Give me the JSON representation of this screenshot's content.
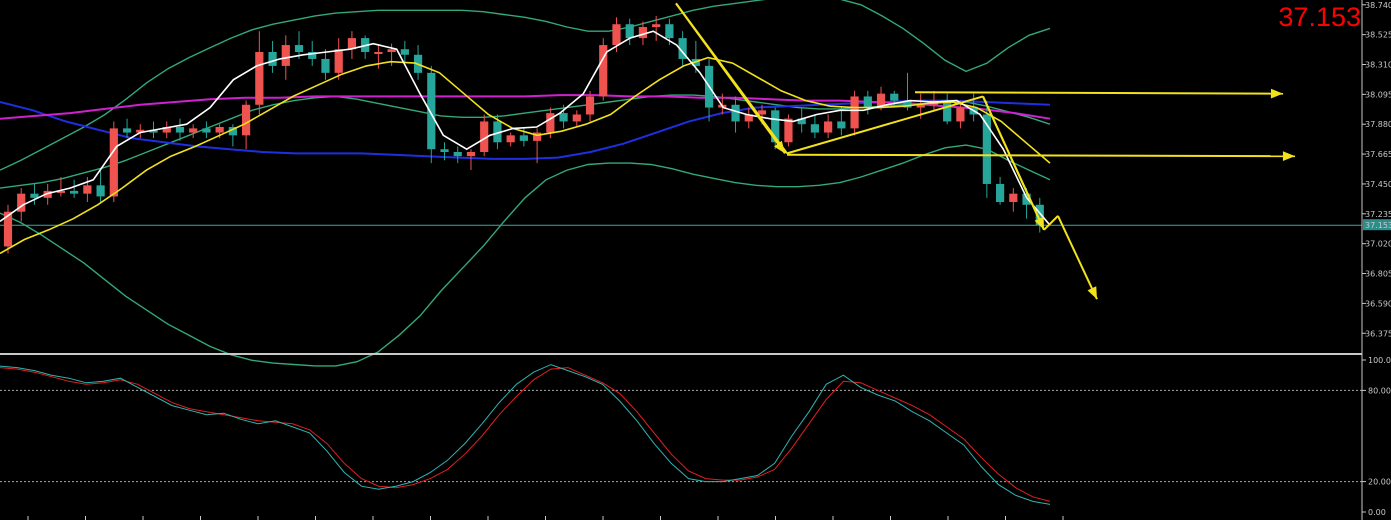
{
  "chart_data": {
    "type": "candlestick",
    "current_price": "37.153",
    "current_price_tag": "37.153",
    "price_axis": {
      "ticks": [
        "38.740",
        "38.525",
        "38.310",
        "38.095",
        "37.880",
        "37.665",
        "37.450",
        "37.235",
        "37.020",
        "36.805",
        "36.590",
        "36.375"
      ],
      "ylim": [
        36.24,
        38.76
      ]
    },
    "oscillator": {
      "type": "stochastic",
      "ticks": [
        "100.00",
        "80.00",
        "20.00",
        "0.00"
      ],
      "levels": [
        80,
        20
      ],
      "ylim": [
        0,
        100
      ]
    },
    "candles": [
      [
        37.0,
        37.3,
        36.95,
        37.25
      ],
      [
        37.25,
        37.42,
        37.18,
        37.38
      ],
      [
        37.38,
        37.45,
        37.3,
        37.35
      ],
      [
        37.35,
        37.45,
        37.3,
        37.4
      ],
      [
        37.4,
        37.5,
        37.36,
        37.4
      ],
      [
        37.4,
        37.48,
        37.35,
        37.38
      ],
      [
        37.38,
        37.5,
        37.32,
        37.44
      ],
      [
        37.44,
        37.55,
        37.32,
        37.36
      ],
      [
        37.36,
        37.9,
        37.32,
        37.85
      ],
      [
        37.85,
        37.92,
        37.78,
        37.82
      ],
      [
        37.82,
        37.88,
        37.78,
        37.84
      ],
      [
        37.84,
        37.9,
        37.78,
        37.82
      ],
      [
        37.82,
        37.9,
        37.78,
        37.86
      ],
      [
        37.86,
        37.92,
        37.76,
        37.82
      ],
      [
        37.82,
        37.88,
        37.78,
        37.85
      ],
      [
        37.85,
        37.9,
        37.78,
        37.82
      ],
      [
        37.82,
        37.88,
        37.78,
        37.86
      ],
      [
        37.86,
        37.88,
        37.72,
        37.8
      ],
      [
        37.8,
        38.05,
        37.7,
        38.02
      ],
      [
        38.02,
        38.55,
        37.95,
        38.4
      ],
      [
        38.4,
        38.48,
        38.25,
        38.3
      ],
      [
        38.3,
        38.52,
        38.2,
        38.45
      ],
      [
        38.45,
        38.55,
        38.35,
        38.4
      ],
      [
        38.4,
        38.48,
        38.3,
        38.35
      ],
      [
        38.35,
        38.42,
        38.2,
        38.25
      ],
      [
        38.25,
        38.5,
        38.2,
        38.42
      ],
      [
        38.42,
        38.55,
        38.35,
        38.5
      ],
      [
        38.5,
        38.52,
        38.35,
        38.4
      ],
      [
        38.4,
        38.45,
        38.28,
        38.4
      ],
      [
        38.4,
        38.46,
        38.3,
        38.42
      ],
      [
        38.42,
        38.48,
        38.32,
        38.38
      ],
      [
        38.38,
        38.45,
        38.2,
        38.25
      ],
      [
        38.25,
        38.3,
        37.6,
        37.7
      ],
      [
        37.7,
        37.75,
        37.62,
        37.68
      ],
      [
        37.68,
        37.72,
        37.6,
        37.65
      ],
      [
        37.65,
        37.7,
        37.55,
        37.68
      ],
      [
        37.68,
        37.95,
        37.65,
        37.9
      ],
      [
        37.9,
        37.95,
        37.7,
        37.75
      ],
      [
        37.75,
        37.82,
        37.72,
        37.8
      ],
      [
        37.8,
        37.85,
        37.72,
        37.76
      ],
      [
        37.76,
        37.85,
        37.6,
        37.82
      ],
      [
        37.82,
        38.0,
        37.78,
        37.96
      ],
      [
        37.96,
        38.02,
        37.85,
        37.9
      ],
      [
        37.9,
        37.98,
        37.86,
        37.95
      ],
      [
        37.95,
        38.12,
        37.9,
        38.08
      ],
      [
        38.08,
        38.5,
        38.05,
        38.45
      ],
      [
        38.45,
        38.65,
        38.4,
        38.6
      ],
      [
        38.6,
        38.64,
        38.45,
        38.5
      ],
      [
        38.5,
        38.62,
        38.45,
        38.58
      ],
      [
        38.58,
        38.66,
        38.48,
        38.6
      ],
      [
        38.6,
        38.64,
        38.45,
        38.5
      ],
      [
        38.5,
        38.55,
        38.3,
        38.35
      ],
      [
        38.35,
        38.48,
        38.25,
        38.3
      ],
      [
        38.3,
        38.35,
        37.9,
        38.0
      ],
      [
        38.0,
        38.1,
        37.95,
        38.02
      ],
      [
        38.02,
        38.08,
        37.82,
        37.9
      ],
      [
        37.9,
        38.0,
        37.85,
        37.95
      ],
      [
        37.95,
        38.02,
        37.88,
        37.98
      ],
      [
        37.98,
        38.0,
        37.7,
        37.75
      ],
      [
        37.75,
        37.95,
        37.72,
        37.92
      ],
      [
        37.92,
        38.0,
        37.82,
        37.88
      ],
      [
        37.88,
        37.95,
        37.78,
        37.82
      ],
      [
        37.82,
        37.95,
        37.78,
        37.9
      ],
      [
        37.9,
        38.0,
        37.8,
        37.85
      ],
      [
        37.85,
        38.12,
        37.8,
        38.08
      ],
      [
        38.08,
        38.12,
        37.95,
        38.0
      ],
      [
        38.0,
        38.15,
        37.98,
        38.1
      ],
      [
        38.1,
        38.12,
        38.0,
        38.05
      ],
      [
        38.05,
        38.25,
        37.98,
        38.0
      ],
      [
        38.0,
        38.1,
        37.92,
        38.02
      ],
      [
        38.02,
        38.12,
        37.98,
        38.05
      ],
      [
        38.05,
        38.1,
        37.88,
        37.9
      ],
      [
        37.9,
        38.05,
        37.85,
        38.0
      ],
      [
        38.0,
        38.1,
        37.9,
        37.95
      ],
      [
        37.95,
        38.05,
        37.35,
        37.45
      ],
      [
        37.45,
        37.5,
        37.3,
        37.32
      ],
      [
        37.32,
        37.42,
        37.25,
        37.38
      ],
      [
        37.38,
        37.42,
        37.2,
        37.3
      ],
      [
        37.3,
        37.35,
        37.1,
        37.153
      ]
    ],
    "bollinger": {
      "upper": [
        37.55,
        37.62,
        37.7,
        37.78,
        37.86,
        37.95,
        38.06,
        38.18,
        38.28,
        38.36,
        38.43,
        38.5,
        38.56,
        38.6,
        38.63,
        38.66,
        38.68,
        38.69,
        38.7,
        38.7,
        38.7,
        38.7,
        38.7,
        38.69,
        38.67,
        38.65,
        38.62,
        38.58,
        38.55,
        38.55,
        38.58,
        38.62,
        38.66,
        38.7,
        38.73,
        38.75,
        38.77,
        38.79,
        38.79,
        38.79,
        38.78,
        38.74,
        38.66,
        38.57,
        38.46,
        38.34,
        38.26,
        38.32,
        38.43,
        38.52,
        38.57
      ],
      "middle": [
        37.42,
        37.44,
        37.46,
        37.49,
        37.53,
        37.57,
        37.62,
        37.68,
        37.74,
        37.8,
        37.86,
        37.92,
        37.98,
        38.02,
        38.05,
        38.07,
        38.08,
        38.06,
        38.03,
        38.0,
        37.97,
        37.94,
        37.93,
        37.93,
        37.94,
        37.96,
        37.98,
        38.0,
        38.02,
        38.04,
        38.06,
        38.08,
        38.09,
        38.09,
        38.08,
        38.06,
        38.04,
        38.02,
        38.0,
        37.99,
        37.99,
        38.0,
        38.01,
        38.02,
        38.03,
        38.04,
        38.04,
        38.01,
        37.97,
        37.93,
        37.88
      ],
      "lower": [
        37.24,
        37.17,
        37.08,
        36.98,
        36.88,
        36.76,
        36.64,
        36.54,
        36.44,
        36.36,
        36.28,
        36.22,
        36.18,
        36.16,
        36.15,
        36.14,
        36.14,
        36.17,
        36.24,
        36.36,
        36.5,
        36.68,
        36.84,
        37.0,
        37.18,
        37.35,
        37.48,
        37.55,
        37.59,
        37.6,
        37.6,
        37.59,
        37.56,
        37.52,
        37.49,
        37.46,
        37.44,
        37.43,
        37.43,
        37.44,
        37.46,
        37.5,
        37.55,
        37.6,
        37.66,
        37.71,
        37.73,
        37.7,
        37.62,
        37.55,
        37.48
      ]
    },
    "ma_fast": [
      37.18,
      37.3,
      37.38,
      37.42,
      37.48,
      37.72,
      37.82,
      37.85,
      37.88,
      38.0,
      38.2,
      38.3,
      38.35,
      38.38,
      38.4,
      38.42,
      38.46,
      38.42,
      38.1,
      37.8,
      37.7,
      37.8,
      37.85,
      37.86,
      37.96,
      38.1,
      38.4,
      38.5,
      38.55,
      38.45,
      38.25,
      38.0,
      37.95,
      37.92,
      37.9,
      37.95,
      37.98,
      37.98,
      38.02,
      38.05,
      38.04,
      38.05,
      37.95,
      37.7,
      37.35,
      37.153
    ],
    "ma_slow": [
      36.95,
      37.05,
      37.12,
      37.2,
      37.3,
      37.42,
      37.55,
      37.65,
      37.72,
      37.8,
      37.88,
      37.98,
      38.08,
      38.16,
      38.24,
      38.3,
      38.33,
      38.32,
      38.25,
      38.1,
      37.95,
      37.85,
      37.8,
      37.83,
      37.88,
      37.95,
      38.08,
      38.2,
      38.3,
      38.36,
      38.32,
      38.22,
      38.12,
      38.05,
      38.01,
      38.0,
      38.0,
      38.01,
      38.03,
      38.04,
      38.0,
      37.9,
      37.75,
      37.6
    ],
    "ma_blue": [
      38.04,
      37.98,
      37.9,
      37.84,
      37.78,
      37.75,
      37.72,
      37.7,
      37.68,
      37.67,
      37.67,
      37.67,
      37.66,
      37.65,
      37.64,
      37.63,
      37.63,
      37.64,
      37.68,
      37.74,
      37.82,
      37.9,
      37.96,
      38.0,
      38.01,
      38.02,
      38.03,
      38.04,
      38.05,
      38.05,
      38.04,
      38.03,
      38.02
    ],
    "ma_magenta": [
      37.92,
      37.94,
      37.96,
      37.99,
      38.02,
      38.04,
      38.06,
      38.07,
      38.07,
      38.08,
      38.08,
      38.08,
      38.08,
      38.08,
      38.08,
      38.08,
      38.09,
      38.09,
      38.08,
      38.08,
      38.07,
      38.07,
      38.06,
      38.05,
      38.05,
      38.04,
      38.03,
      38.01,
      37.99,
      37.96,
      37.92
    ],
    "stoch_main": [
      96,
      95,
      93,
      90,
      88,
      85,
      86,
      88,
      82,
      76,
      70,
      67,
      64,
      65,
      61,
      58,
      60,
      56,
      52,
      40,
      26,
      17,
      15,
      17,
      20,
      26,
      34,
      45,
      58,
      72,
      84,
      92,
      97,
      93,
      89,
      84,
      73,
      60,
      45,
      32,
      22,
      20,
      20,
      22,
      24,
      32,
      50,
      66,
      84,
      90,
      82,
      77,
      73,
      66,
      60,
      52,
      44,
      30,
      18,
      11,
      7,
      5
    ],
    "stoch_signal": [
      95,
      94,
      92,
      89,
      86,
      84,
      85,
      87,
      84,
      78,
      72,
      68,
      66,
      64,
      62,
      60,
      59,
      58,
      54,
      45,
      32,
      22,
      17,
      16,
      18,
      22,
      28,
      38,
      50,
      64,
      76,
      87,
      94,
      95,
      90,
      85,
      78,
      66,
      52,
      38,
      27,
      22,
      21,
      21,
      23,
      28,
      42,
      58,
      74,
      86,
      85,
      80,
      75,
      70,
      64,
      56,
      48,
      36,
      25,
      16,
      10,
      7
    ],
    "arrows": [
      {
        "from": [
          0.0,
          38.75
        ],
        "to": [
          0.0,
          37.67
        ]
      },
      {
        "from": [
          0.0,
          37.67
        ],
        "to": [
          0.0,
          38.08
        ]
      },
      {
        "from": [
          0.0,
          38.08
        ],
        "to": [
          0.0,
          37.12
        ]
      },
      {
        "from": [
          0.0,
          37.12
        ],
        "to": [
          0.0,
          37.22
        ]
      },
      {
        "from": [
          0.0,
          37.22
        ],
        "to": [
          0.0,
          36.62
        ]
      },
      {
        "from": [
          0.0,
          38.11
        ],
        "to": [
          0.0,
          38.1
        ]
      },
      {
        "from": [
          0.0,
          37.66
        ],
        "to": [
          0.0,
          37.65
        ]
      }
    ]
  }
}
